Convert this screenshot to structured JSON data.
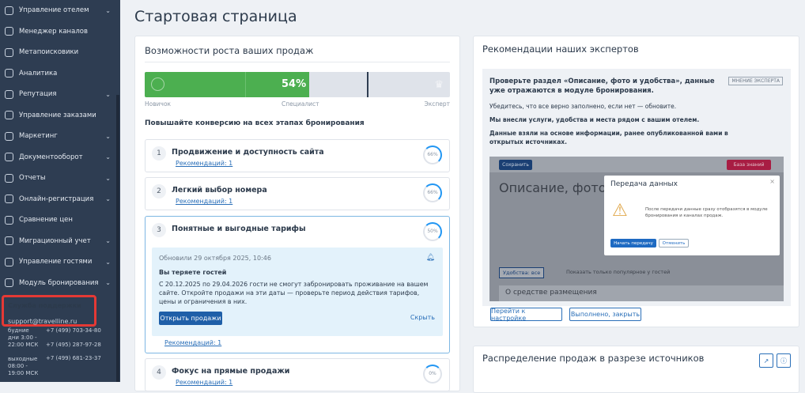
{
  "sidebar": {
    "items": [
      {
        "label": "Управление отелем",
        "chev": true
      },
      {
        "label": "Менеджер каналов"
      },
      {
        "label": "Метапоисковики"
      },
      {
        "label": "Аналитика"
      },
      {
        "label": "Репутация",
        "chev": true
      },
      {
        "label": "Управление заказами"
      },
      {
        "label": "Маркетинг",
        "chev": true
      },
      {
        "label": "Документооборот",
        "chev": true
      },
      {
        "label": "Отчеты",
        "chev": true
      },
      {
        "label": "Онлайн-регистрация",
        "chev": true
      },
      {
        "label": "Сравнение цен"
      },
      {
        "label": "Миграционный учет",
        "chev": true
      },
      {
        "label": "Управление гостями",
        "chev": true
      },
      {
        "label": "Модуль бронирования",
        "chev": true
      }
    ],
    "support": {
      "title": "Служба поддержки",
      "email": "support@travelline.ru",
      "weekdays": "будние дни 3:00 - 22:00 МСК",
      "weekends": "выходные 08:00 - 19:00 МСК",
      "phones": [
        "+7 (499) 703-34-80",
        "+7 (495) 287-97-28",
        "+7 (499) 681-23-37"
      ]
    }
  },
  "page_title": "Стартовая страница",
  "growth": {
    "title": "Возможности роста ваших продаж",
    "progress_percent": 54,
    "progress_label": "54%",
    "levels": [
      "Новичок",
      "Специалист",
      "Эксперт"
    ],
    "subtitle": "Повышайте конверсию на всех этапах бронирования",
    "steps": [
      {
        "n": "1",
        "title": "Продвижение и доступность сайта",
        "rec": "Рекомендаций: 1",
        "pct": "66%"
      },
      {
        "n": "2",
        "title": "Легкий выбор номера",
        "rec": "Рекомендаций: 1",
        "pct": "66%"
      },
      {
        "n": "3",
        "title": "Понятные и выгодные тарифы",
        "rec": "Рекомендаций: 1",
        "pct": "50%"
      },
      {
        "n": "4",
        "title": "Фокус на прямые продажи",
        "rec": "Рекомендаций: 1",
        "pct": "0%"
      }
    ],
    "alert": {
      "updated": "Обновили 29 октября 2025, 10:46",
      "heading": "Вы теряете гостей",
      "text": "С 20.12.2025 по 29.04.2026 гости не смогут забронировать проживание на вашем сайте. Откройте продажи на эти даты — проверьте период действия тарифов, цены и ограничения в них.",
      "open": "Открыть продажи",
      "hide": "Скрыть"
    }
  },
  "experts": {
    "title": "Рекомендации наших экспертов",
    "heading": "Проверьте раздел «Описание, фото и удобства», данные уже отражаются в модуле бронирования.",
    "badge": "МНЕНИЕ ЭКСПЕРТА",
    "p1": "Убедитесь, что все верно заполнено, если нет — обновите.",
    "p2": "Мы внесли услуги, удобства и места рядом с вашим отелем.",
    "p3": "Данные взяли на основе информации, ранее опубликованной вами в открытых источниках.",
    "shot": {
      "save": "Сохранить",
      "kb": "База знаний",
      "title": "Описание, фото и удо",
      "dialog_title": "Передача данных",
      "dialog_text": "После передачи данные сразу отобразятся в модуле бронирования и каналах продаж.",
      "start": "Начать передачу",
      "cancel": "Отменить",
      "amen": "Удобства: все",
      "popular": "Показать только популярное у гостей",
      "section": "О средстве размещения"
    },
    "go": "Перейти к настройке",
    "done": "Выполнено, закрыть"
  },
  "distribution": {
    "title": "Распределение продаж в разрезе источников"
  }
}
